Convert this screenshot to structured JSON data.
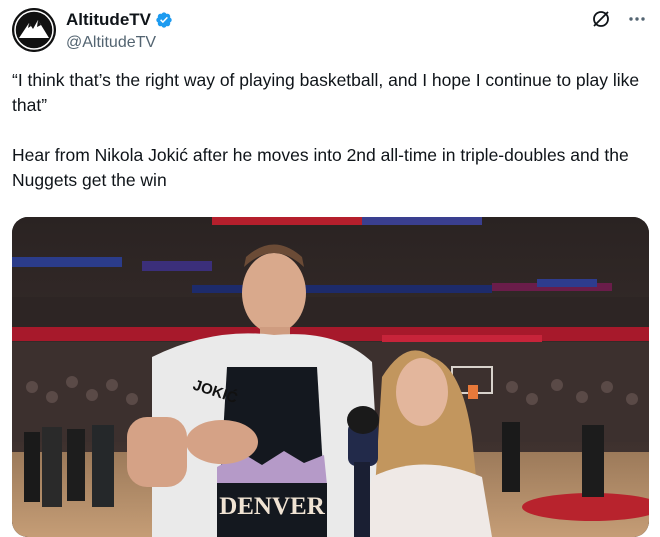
{
  "account": {
    "display_name": "AltitudeTV",
    "handle": "@AltitudeTV",
    "verified": true,
    "avatar_icon": "mountain-logo-icon"
  },
  "header_actions": {
    "grok_icon": "slash-circle-icon",
    "more_icon": "more-dots-icon"
  },
  "tweet": {
    "quote": "“I think that’s the right way of playing basketball, and I hope I continue to play like that”",
    "text": "Hear from Nikola Jokić after he moves into 2nd all-time in triple-doubles and the Nuggets get the win"
  },
  "media": {
    "jersey_text": "DENVER",
    "towel_text": "JOKIĆ"
  },
  "colors": {
    "verified_blue": "#1d9bf0",
    "text_primary": "#0f1419",
    "text_secondary": "#536471"
  }
}
